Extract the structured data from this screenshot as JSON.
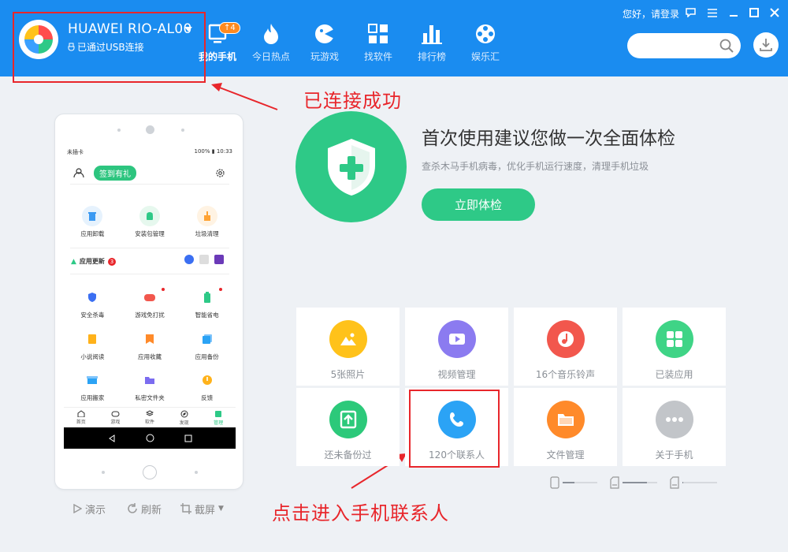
{
  "header": {
    "device_name": "HUAWEI RIO-AL00",
    "usb_status": "已通过USB连接",
    "login": "您好，请登录",
    "search_placeholder": "",
    "nav": [
      {
        "label": "我的手机",
        "badge": "4",
        "icon": "phone-icon",
        "active": true
      },
      {
        "label": "今日热点",
        "icon": "flame-icon"
      },
      {
        "label": "玩游戏",
        "icon": "game-icon"
      },
      {
        "label": "找软件",
        "icon": "apps-grid-icon"
      },
      {
        "label": "排行榜",
        "icon": "bar-chart-icon"
      },
      {
        "label": "娱乐汇",
        "icon": "film-reel-icon"
      }
    ]
  },
  "annotations": {
    "connected": "已连接成功",
    "contacts_hint": "点击进入手机联系人"
  },
  "phone": {
    "status_left": "未插卡",
    "status_right": "100%",
    "time": "10:33",
    "sign_in": "签到有礼",
    "tools_row1": [
      "应用卸载",
      "安装包管理",
      "垃圾清理"
    ],
    "update_label": "应用更新",
    "update_count": "3",
    "tools_row2": [
      "安全杀毒",
      "游戏免打扰",
      "智能省电"
    ],
    "tools_row3": [
      "小说阅读",
      "应用收藏",
      "应用备份"
    ],
    "tools_row4": [
      "应用搬家",
      "私密文件夹",
      "反馈"
    ],
    "tabs": [
      "首页",
      "游戏",
      "软件",
      "发现",
      "管理"
    ],
    "actions": {
      "demo": "演示",
      "refresh": "刷新",
      "screenshot": "截屏"
    }
  },
  "checkup": {
    "title": "首次使用建议您做一次全面体检",
    "desc": "查杀木马手机病毒，优化手机运行速度，清理手机垃圾",
    "button": "立即体检"
  },
  "tiles": [
    {
      "label": "5张照片",
      "icon": "photo-icon",
      "color": "#ffc21a"
    },
    {
      "label": "视频管理",
      "icon": "video-icon",
      "color": "#8b7bf0"
    },
    {
      "label": "16个音乐铃声",
      "icon": "music-icon",
      "color": "#f2574d"
    },
    {
      "label": "已装应用",
      "icon": "installed-apps-icon",
      "color": "#3fd486"
    },
    {
      "label": "还未备份过",
      "icon": "backup-icon",
      "color": "#2cc97a"
    },
    {
      "label": "120个联系人",
      "icon": "contacts-phone-icon",
      "color": "#2ba3f5"
    },
    {
      "label": "文件管理",
      "icon": "folder-icon",
      "color": "#ff8a2a"
    },
    {
      "label": "关于手机",
      "icon": "more-icon",
      "color": "#c2c5c9"
    }
  ],
  "storage_fill": [
    0.35,
    0.7,
    0.03
  ]
}
